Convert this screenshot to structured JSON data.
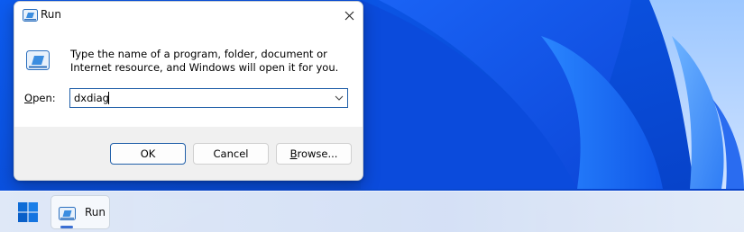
{
  "dialog": {
    "title": "Run",
    "description": "Type the name of a program, folder, document or Internet resource, and Windows will open it for you.",
    "open_label_prefix": "",
    "open_label_access": "O",
    "open_label_rest": "pen:",
    "input_value": "dxdiag",
    "buttons": {
      "ok": "OK",
      "cancel": "Cancel",
      "browse_access": "B",
      "browse_rest": "rowse..."
    }
  },
  "taskbar": {
    "run_label": "Run"
  },
  "colors": {
    "focus_border": "#1f5ea8",
    "wallpaper_blue": "#0a52e6",
    "footer": "#f0f0f0"
  },
  "icons": [
    "run-icon",
    "close-icon",
    "chevron-down-icon",
    "windows-start-icon"
  ]
}
